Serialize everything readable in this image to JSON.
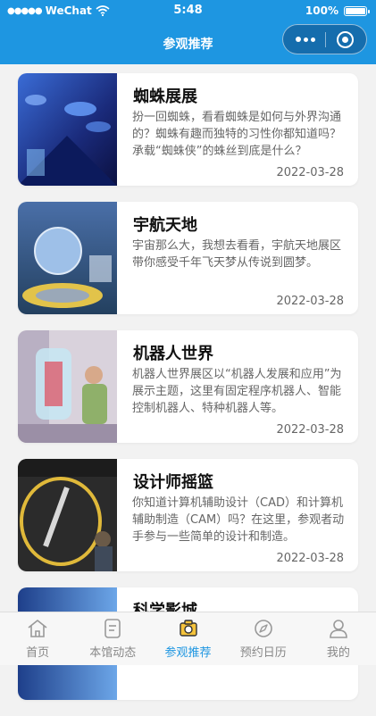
{
  "status": {
    "carrier": "WeChat",
    "time": "5:48",
    "battery": "100%"
  },
  "nav": {
    "title": "参观推荐"
  },
  "cards": [
    {
      "title": "蜘蛛展展",
      "desc": "扮一回蜘蛛，看看蜘蛛是如何与外界沟通的？蜘蛛有趣而独特的习性你都知道吗？承载“蜘蛛侠”的蛛丝到底是什么？",
      "date": "2022-03-28"
    },
    {
      "title": "宇航天地",
      "desc": "宇宙那么大，我想去看看，宇航天地展区带你感受千年飞天梦从传说到圆梦。",
      "date": "2022-03-28"
    },
    {
      "title": "机器人世界",
      "desc": "机器人世界展区以“机器人发展和应用”为展示主题，这里有固定程序机器人、智能控制机器人、特种机器人等。",
      "date": "2022-03-28"
    },
    {
      "title": "设计师摇篮",
      "desc": "你知道计算机辅助设计（CAD）和计算机辅助制造（CAM）吗？在这里，参观者动手参与一些简单的设计和制造。",
      "date": "2022-03-28"
    },
    {
      "title": "科学影城",
      "desc": "",
      "date": ""
    }
  ],
  "tabs": [
    {
      "label": "首页",
      "icon": "home-icon"
    },
    {
      "label": "本馆动态",
      "icon": "news-icon"
    },
    {
      "label": "参观推荐",
      "icon": "camera-icon"
    },
    {
      "label": "预约日历",
      "icon": "compass-icon"
    },
    {
      "label": "我的",
      "icon": "user-icon"
    }
  ],
  "colors": {
    "primary": "#1e96e1",
    "background": "#f2f2f2",
    "tab_inactive": "#888888"
  }
}
